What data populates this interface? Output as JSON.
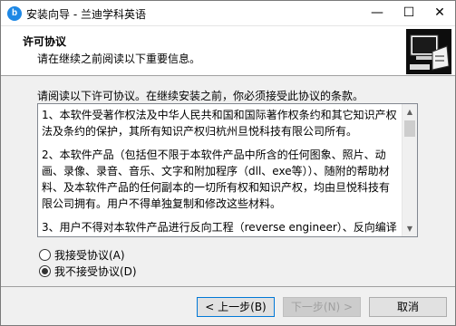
{
  "window": {
    "title": "安装向导 - 兰迪学科英语",
    "app_icon_glyph": "b",
    "minimize_glyph": "—",
    "maximize_glyph": "☐",
    "close_glyph": "✕"
  },
  "header": {
    "title": "许可协议",
    "subtitle": "请在继续之前阅读以下重要信息。"
  },
  "main": {
    "intro": "请阅读以下许可协议。在继续安装之前，你必须接受此协议的条款。",
    "license_paragraphs": [
      "1、本软件受著作权法及中华人民共和国和国际著作权条约和其它知识产权法及条约的保护，其所有知识产权归杭州旦悦科技有限公司所有。",
      "2、本软件产品（包括但不限于本软件产品中所含的任何图象、照片、动画、录像、录音、音乐、文字和附加程序（dll、exe等））、随附的帮助材料、及本软件产品的任何副本的一切所有权和知识产权，均由旦悦科技有限公司拥有。用户不得单独复制和修改这些材料。",
      "3、用户不得对本软件产品进行反向工程（reverse engineer）、反向编译"
    ],
    "radio_accept_label": "我接受协议(A)",
    "radio_decline_label": "我不接受协议(D)",
    "selected": "decline"
  },
  "footer": {
    "back_label": "< 上一步(B)",
    "next_label": "下一步(N) >",
    "cancel_label": "取消"
  }
}
